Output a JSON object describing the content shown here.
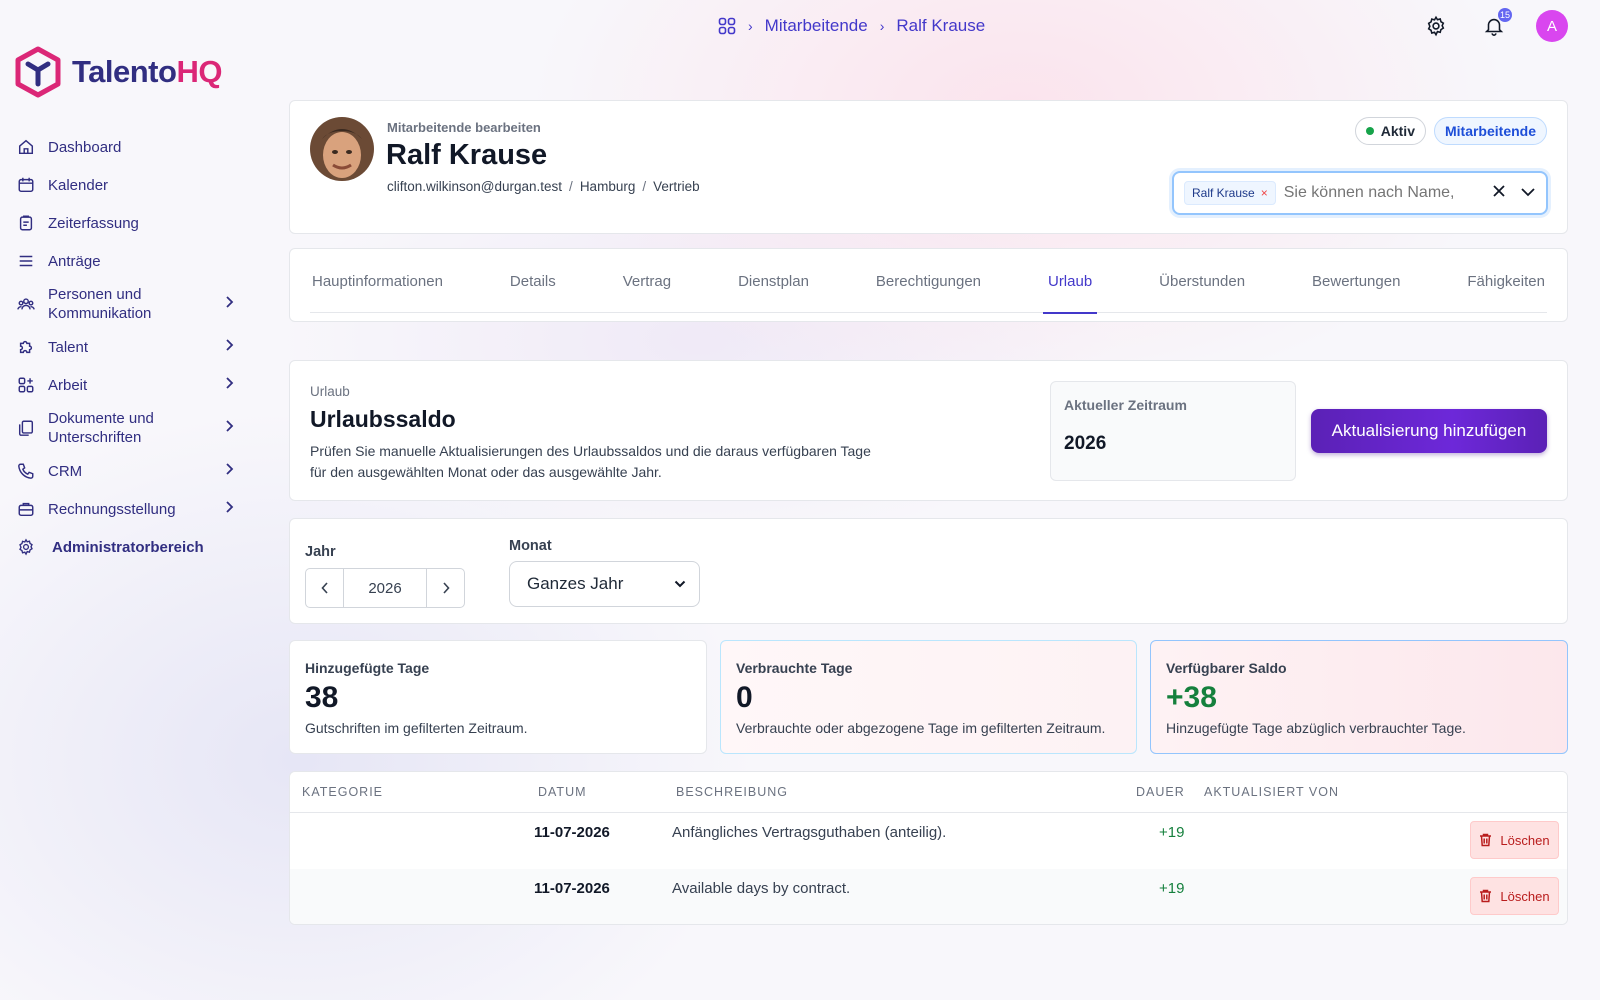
{
  "breadcrumb": {
    "items": [
      "Mitarbeitende",
      "Ralf Krause"
    ]
  },
  "topbar": {
    "notification_count": "15",
    "avatar_initial": "A"
  },
  "brand": {
    "part1": "Talento",
    "part2": "HQ"
  },
  "sidebar": {
    "items": [
      {
        "label": "Dashboard",
        "icon": "home-icon"
      },
      {
        "label": "Kalender",
        "icon": "calendar-icon"
      },
      {
        "label": "Zeiterfassung",
        "icon": "clipboard-icon"
      },
      {
        "label": "Anträge",
        "icon": "list-icon"
      },
      {
        "label": "Personen und Kommunikation",
        "icon": "users-icon"
      },
      {
        "label": "Talent",
        "icon": "puzzle-icon"
      },
      {
        "label": "Arbeit",
        "icon": "grid-plus-icon"
      },
      {
        "label": "Dokumente und Unterschriften",
        "icon": "documents-icon"
      },
      {
        "label": "CRM",
        "icon": "phone-icon"
      },
      {
        "label": "Rechnungsstellung",
        "icon": "briefcase-icon"
      },
      {
        "label": "Administratorbereich",
        "icon": "gear-icon"
      }
    ]
  },
  "employee": {
    "edit_label": "Mitarbeitende bearbeiten",
    "name": "Ralf Krause",
    "email": "clifton.wilkinson@durgan.test",
    "city": "Hamburg",
    "department": "Vertrieb",
    "status": "Aktiv",
    "role_badge": "Mitarbeitende"
  },
  "picker": {
    "chip_label": "Ralf Krause",
    "placeholder": "Sie können nach Name, E-Mail oder Abteilung suchen"
  },
  "tabs": [
    "Hauptinformationen",
    "Details",
    "Vertrag",
    "Dienstplan",
    "Berechtigungen",
    "Urlaub",
    "Überstunden",
    "Bewertungen",
    "Fähigkeiten"
  ],
  "active_tab": "Urlaub",
  "leave": {
    "section_label": "Urlaub",
    "title": "Urlaubssaldo",
    "description": "Prüfen Sie manuelle Aktualisierungen des Urlaubssaldos und die daraus verfügbaren Tage für den ausgewählten Monat oder das ausgewählte Jahr.",
    "period_label": "Aktueller Zeitraum",
    "period_value": "2026",
    "add_button": "Aktualisierung hinzufügen"
  },
  "filters": {
    "year_label": "Jahr",
    "year_value": "2026",
    "month_label": "Monat",
    "month_value": "Ganzes Jahr"
  },
  "stats": [
    {
      "title": "Hinzugefügte Tage",
      "value": "38",
      "sub": "Gutschriften im gefilterten Zeitraum."
    },
    {
      "title": "Verbrauchte Tage",
      "value": "0",
      "sub": "Verbrauchte oder abgezogene Tage im gefilterten Zeitraum."
    },
    {
      "title": "Verfügbarer Saldo",
      "value": "+38",
      "sub": "Hinzugefügte Tage abzüglich verbrauchter Tage."
    }
  ],
  "table": {
    "headers": [
      "KATEGORIE",
      "DATUM",
      "BESCHREIBUNG",
      "DAUER",
      "AKTUALISIERT VON"
    ],
    "rows": [
      {
        "category": "",
        "date": "11-07-2026",
        "description": "Anfängliches Vertragsguthaben (anteilig).",
        "duration": "+19",
        "updated_by": "",
        "action": "Löschen"
      },
      {
        "category": "",
        "date": "11-07-2026",
        "description": "Available days by contract.",
        "duration": "+19",
        "updated_by": "",
        "action": "Löschen"
      }
    ]
  },
  "colors": {
    "accent": "#4338ca",
    "primary_button": "#5b21b6",
    "brand_pink": "#db2777",
    "positive": "#15803d",
    "delete": "#b91c1c"
  }
}
